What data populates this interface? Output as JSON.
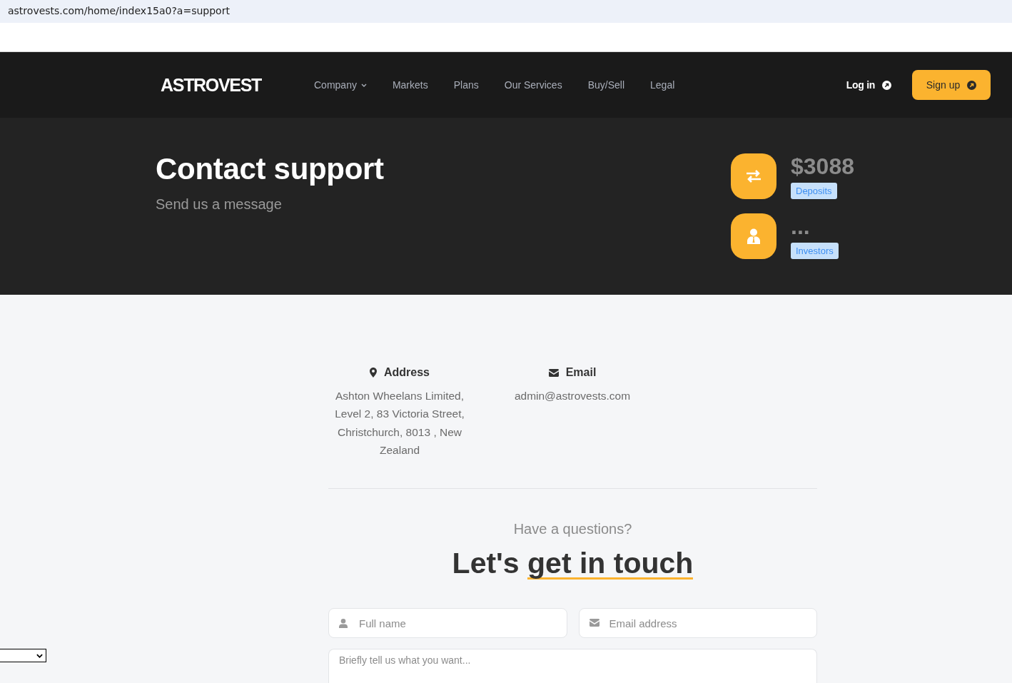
{
  "browser": {
    "url": "astrovests.com/home/index15a0?a=support"
  },
  "navbar": {
    "logo": "ASTROVEST",
    "links": [
      {
        "label": "Company",
        "has_menu": true
      },
      {
        "label": "Markets",
        "has_menu": false
      },
      {
        "label": "Plans",
        "has_menu": false
      },
      {
        "label": "Our Services",
        "has_menu": false
      },
      {
        "label": "Buy/Sell",
        "has_menu": false
      },
      {
        "label": "Legal",
        "has_menu": false
      }
    ],
    "login": "Log in",
    "signup": "Sign up"
  },
  "hero": {
    "title": "Contact support",
    "subtitle": "Send us a message",
    "stats": [
      {
        "kind": "deposits",
        "value": "$3088",
        "label": "Deposits"
      },
      {
        "kind": "investors",
        "value": "...",
        "label": "Investors"
      }
    ]
  },
  "contact_info": [
    {
      "kind": "address",
      "heading": "Address",
      "text": "Ashton Wheelans Limited, Level 2, 83 Victoria Street, Christchurch, 8013 , New Zealand"
    },
    {
      "kind": "email",
      "heading": "Email",
      "text": "admin@astrovests.com"
    }
  ],
  "contact_form": {
    "kicker": "Have a questions?",
    "heading": "Let's",
    "heading_highlight": "get in touch",
    "fields": [
      {
        "kind": "name",
        "placeholder": "Full name"
      },
      {
        "kind": "email",
        "placeholder": "Email address"
      },
      {
        "kind": "message",
        "placeholder": "Briefly tell us what you want..."
      }
    ]
  },
  "floating_controls": [
    {
      "kind": "select"
    }
  ]
}
